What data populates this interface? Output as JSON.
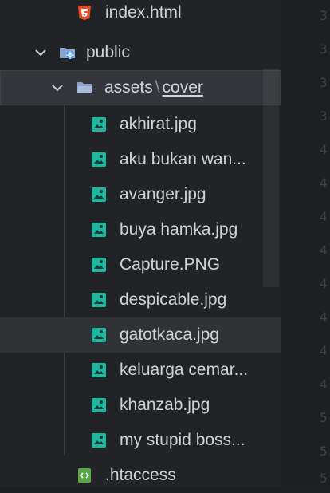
{
  "explorer": {
    "index_file": "index.html",
    "public_folder": "public",
    "assets_folder": "assets",
    "path_separator": "\\",
    "cover_folder": "cover",
    "cover_files": [
      "akhirat.jpg",
      "aku bukan wan...",
      "avanger.jpg",
      "buya hamka.jpg",
      "Capture.PNG",
      "despicable.jpg",
      "gatotkaca.jpg",
      "keluarga cemar...",
      "khanzab.jpg",
      "my stupid boss..."
    ],
    "htaccess_file": ".htaccess"
  },
  "gutter": {
    "line_numbers": [
      "3",
      "3",
      "3",
      "3",
      "4",
      "4",
      "4",
      "4",
      "4",
      "4",
      "4",
      "4",
      "5",
      "5",
      "5"
    ]
  },
  "colors": {
    "image_icon": "#1fb7a0",
    "html_icon": "#e44d26",
    "folder": "#8aa4c8",
    "globe": "#3aa0ff",
    "htaccess_icon": "#57a846"
  },
  "icons": {
    "html": "html5-icon",
    "folder_public": "folder-globe-icon",
    "folder": "folder-open-icon",
    "image": "image-file-icon",
    "htaccess": "htaccess-file-icon",
    "chevron": "chevron-down-icon"
  }
}
